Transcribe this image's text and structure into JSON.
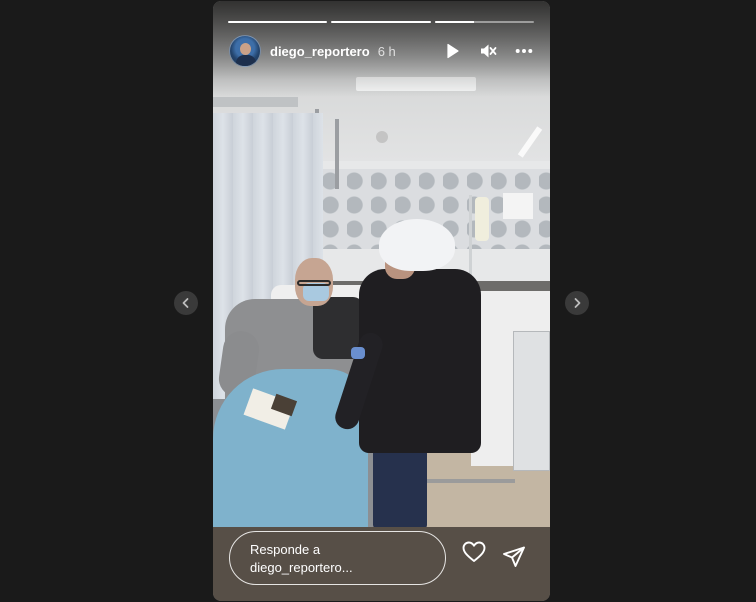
{
  "story": {
    "username": "diego_reportero",
    "time_ago": "6 h",
    "progress": [
      1.0,
      1.0,
      0.4
    ],
    "reply_placeholder": "Responde a diego_reportero..."
  },
  "icons": {
    "avatar": "user-avatar",
    "play": "play-icon",
    "mute": "speaker-muted-icon",
    "more": "more-horizontal-icon",
    "like": "heart-icon",
    "share": "send-icon",
    "prev": "chevron-left-icon",
    "next": "chevron-right-icon"
  },
  "colors": {
    "page_background": "#1a1a1a",
    "nav_button": "#3a3a3a",
    "text": "#ffffff"
  }
}
